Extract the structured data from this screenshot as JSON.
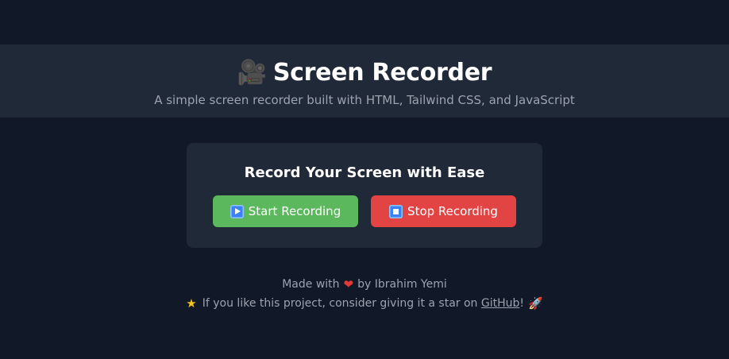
{
  "header": {
    "title_emoji": "🎥",
    "title": "Screen Recorder",
    "subtitle": "A simple screen recorder built with HTML, Tailwind CSS, and JavaScript"
  },
  "card": {
    "heading": "Record Your Screen with Ease",
    "start_label": "Start Recording",
    "stop_label": "Stop Recording"
  },
  "footer": {
    "made_with": "Made with",
    "heart": "❤",
    "by": "by Ibrahim Yemi",
    "star": "★",
    "star_text": "If you like this project, consider giving it a star on",
    "link_text": "GitHub",
    "after_link": "!",
    "rocket": "🚀"
  },
  "colors": {
    "background": "#111827",
    "panel": "#1f2937",
    "start_button": "#5cb85c",
    "stop_button": "#e24343",
    "muted_text": "#9ca3af"
  },
  "icons": {
    "title": "movie-camera-icon",
    "start": "play-icon",
    "stop": "stop-icon",
    "heart": "heart-icon",
    "star": "star-icon",
    "rocket": "rocket-icon"
  }
}
